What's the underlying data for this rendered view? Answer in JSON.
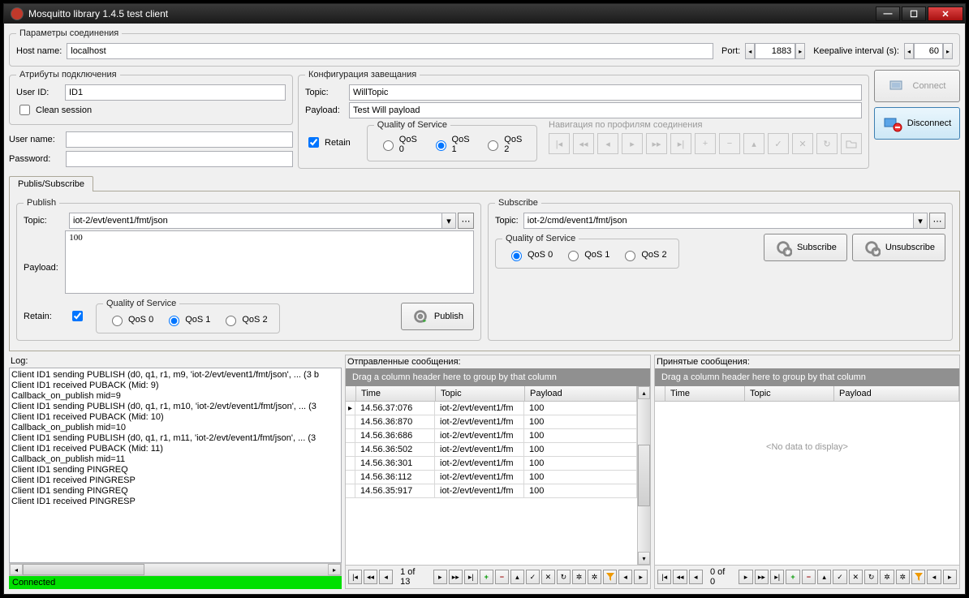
{
  "window": {
    "title": "Mosquitto library 1.4.5 test client"
  },
  "conn_params": {
    "legend": "Параметры соединения",
    "host_label": "Host name:",
    "host_value": "localhost",
    "port_label": "Port:",
    "port_value": "1883",
    "keepalive_label": "Keepalive interval (s):",
    "keepalive_value": "60"
  },
  "conn_attrs": {
    "legend": "Атрибуты подключения",
    "userid_label": "User ID:",
    "userid_value": "ID1",
    "clean_label": "Clean session",
    "username_label": "User name:",
    "username_value": "",
    "password_label": "Password:",
    "password_value": ""
  },
  "will": {
    "legend": "Конфигурация завещания",
    "topic_label": "Topic:",
    "topic_value": "WillTopic",
    "payload_label": "Payload:",
    "payload_value": "Test Will payload",
    "retain_label": "Retain",
    "qos_legend": "Quality of Service",
    "qos0": "QoS 0",
    "qos1": "QoS 1",
    "qos2": "QoS 2"
  },
  "nav": {
    "legend": "Навигация по профилям соединения"
  },
  "buttons": {
    "connect": "Connect",
    "disconnect": "Disconnect",
    "publish": "Publish",
    "subscribe": "Subscribe",
    "unsubscribe": "Unsubscribe"
  },
  "tab": {
    "label": "Publis/Subscribe"
  },
  "publish": {
    "legend": "Publish",
    "topic_label": "Topic:",
    "topic_value": "iot-2/evt/event1/fmt/json",
    "payload_label": "Payload:",
    "payload_value": "100",
    "retain_label": "Retain:",
    "qos_legend": "Quality of Service",
    "qos0": "QoS 0",
    "qos1": "QoS 1",
    "qos2": "QoS 2"
  },
  "subscribe": {
    "legend": "Subscribe",
    "topic_label": "Topic:",
    "topic_value": "iot-2/cmd/event1/fmt/json",
    "qos_legend": "Quality of Service",
    "qos0": "QoS 0",
    "qos1": "QoS 1",
    "qos2": "QoS 2"
  },
  "log": {
    "label": "Log:",
    "lines": [
      "Client ID1 sending PUBLISH (d0, q1, r1, m9, 'iot-2/evt/event1/fmt/json', ... (3 b",
      "Client ID1 received PUBACK (Mid: 9)",
      "Callback_on_publish mid=9",
      "Client ID1 sending PUBLISH (d0, q1, r1, m10, 'iot-2/evt/event1/fmt/json', ... (3",
      "Client ID1 received PUBACK (Mid: 10)",
      "Callback_on_publish mid=10",
      "Client ID1 sending PUBLISH (d0, q1, r1, m11, 'iot-2/evt/event1/fmt/json', ... (3",
      "Client ID1 received PUBACK (Mid: 11)",
      "Callback_on_publish mid=11",
      "Client ID1 sending PINGREQ",
      "Client ID1 received PINGRESP",
      "Client ID1 sending PINGREQ",
      "Client ID1 received PINGRESP"
    ]
  },
  "sent": {
    "title": "Отправленные сообщения:",
    "group_hint": "Drag a column header here to group by that column",
    "col_time": "Time",
    "col_topic": "Topic",
    "col_payload": "Payload",
    "rows": [
      {
        "time": "14.56.37:076",
        "topic": "iot-2/evt/event1/fm",
        "payload": "100",
        "current": true
      },
      {
        "time": "14.56.36:870",
        "topic": "iot-2/evt/event1/fm",
        "payload": "100"
      },
      {
        "time": "14.56.36:686",
        "topic": "iot-2/evt/event1/fm",
        "payload": "100"
      },
      {
        "time": "14.56.36:502",
        "topic": "iot-2/evt/event1/fm",
        "payload": "100"
      },
      {
        "time": "14.56.36:301",
        "topic": "iot-2/evt/event1/fm",
        "payload": "100"
      },
      {
        "time": "14.56.36:112",
        "topic": "iot-2/evt/event1/fm",
        "payload": "100"
      },
      {
        "time": "14.56.35:917",
        "topic": "iot-2/evt/event1/fm",
        "payload": "100"
      }
    ],
    "pager": "1 of 13"
  },
  "recv": {
    "title": "Принятые сообщения:",
    "group_hint": "Drag a column header here to group by that column",
    "col_time": "Time",
    "col_topic": "Topic",
    "col_payload": "Payload",
    "nodata": "<No data to display>",
    "pager": "0 of 0"
  },
  "status": {
    "text": "Connected"
  }
}
